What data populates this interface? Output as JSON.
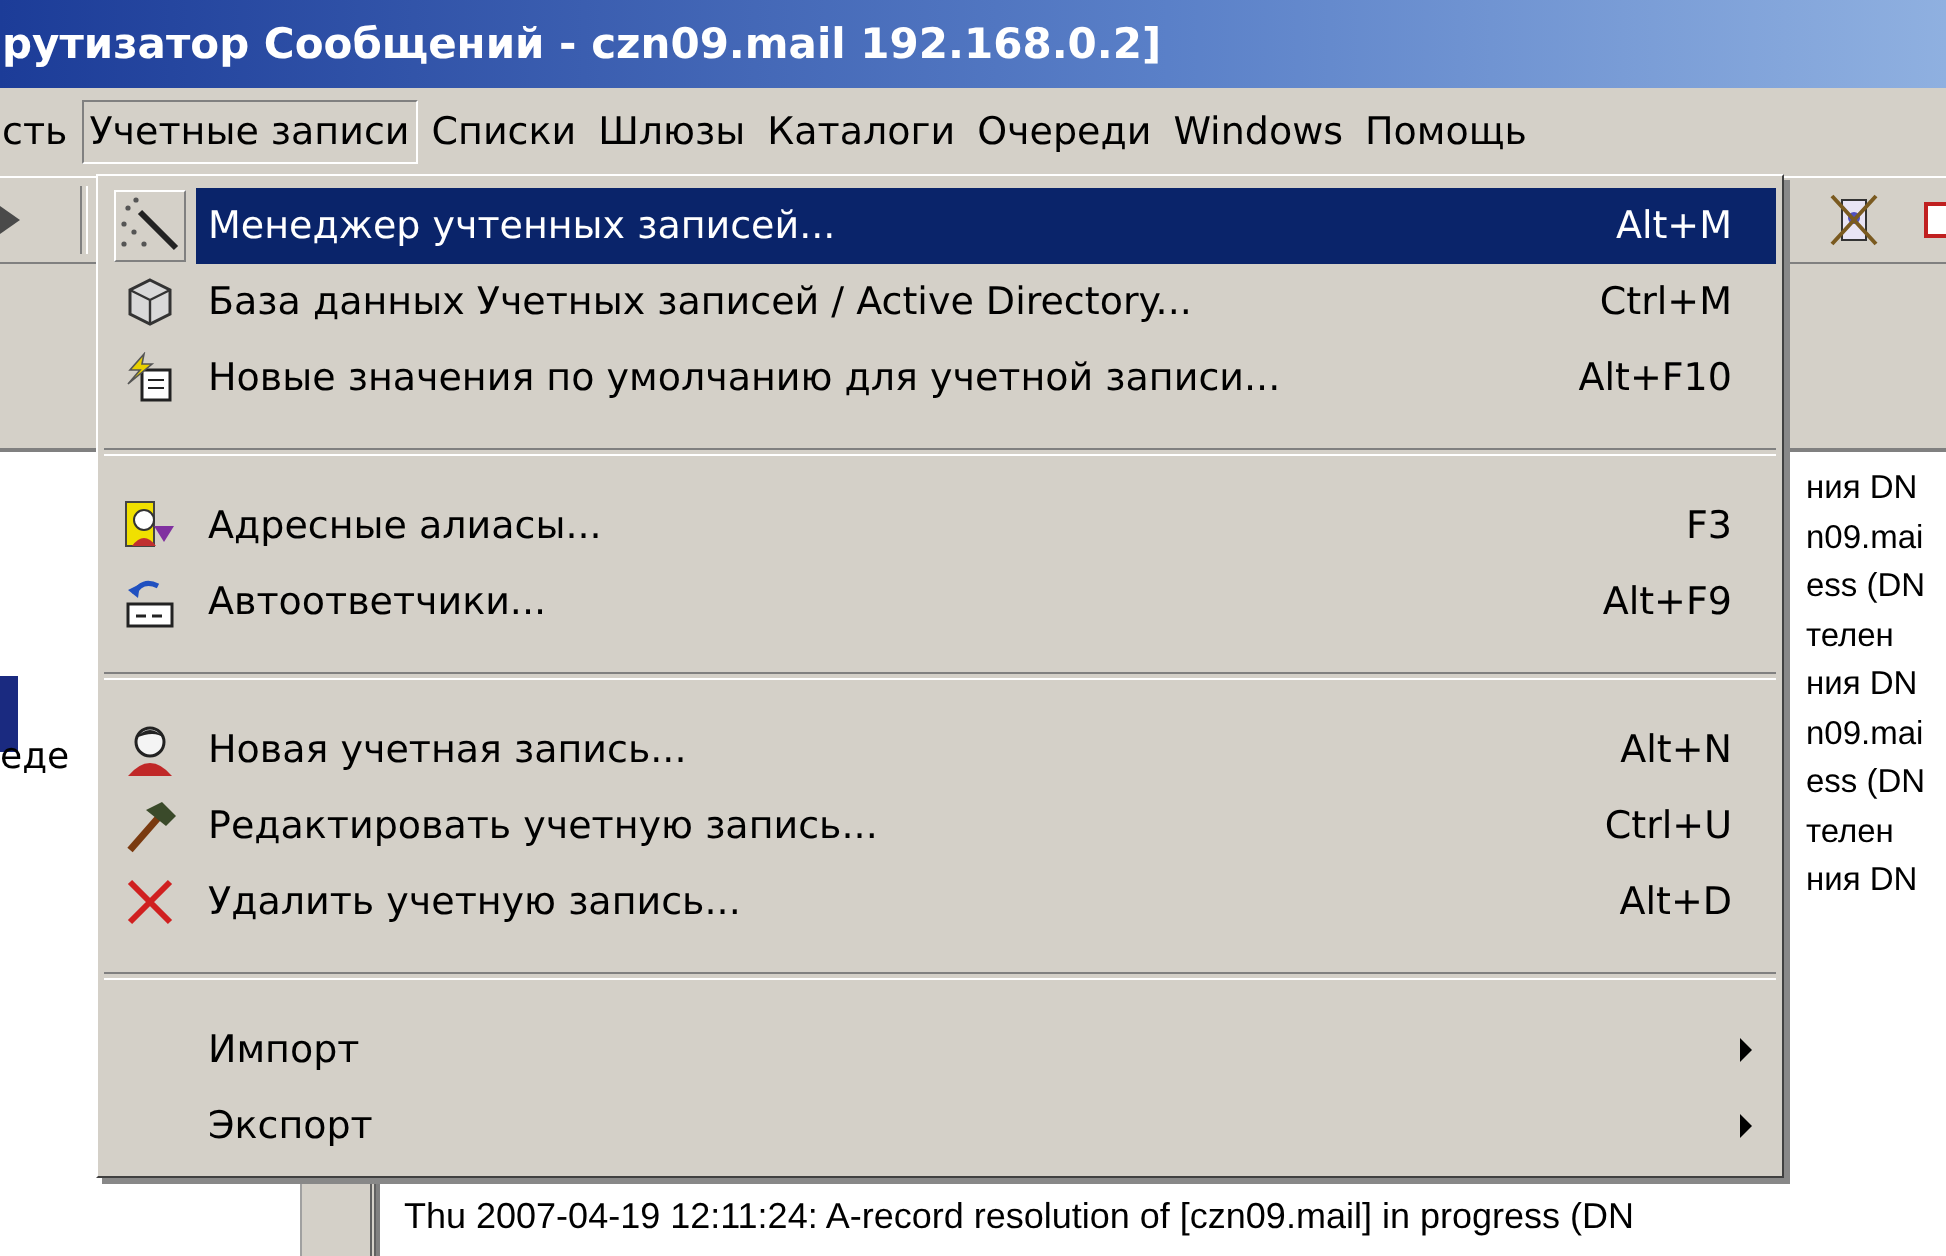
{
  "window": {
    "title": "рутизатор Сообщений  - czn09.mail 192.168.0.2]"
  },
  "menu_bar": [
    {
      "label": "сть",
      "selected": false
    },
    {
      "label": "Учетные записи",
      "selected": true
    },
    {
      "label": "Списки",
      "selected": false
    },
    {
      "label": "Шлюзы",
      "selected": false
    },
    {
      "label": "Каталоги",
      "selected": false
    },
    {
      "label": "Очереди",
      "selected": false
    },
    {
      "label": "Windows",
      "selected": false
    },
    {
      "label": "Помощь",
      "selected": false
    }
  ],
  "side_panel": {
    "text": "еде"
  },
  "log_fragments": [
    "ния DN",
    "n09.mai",
    "ess (DN",
    "телен",
    "ния DN",
    "n09.mai",
    "ess (DN",
    "телен",
    "ния DN"
  ],
  "log_lines": [
    "Thu 2007-04-19 12:11:24: A-record resolution of [czn09.mail] in progress (DN"
  ],
  "dropdown": {
    "items": [
      {
        "kind": "item",
        "label": "Менеджер учтенных записей...",
        "shortcut": "Alt+M",
        "selected": true
      },
      {
        "kind": "item",
        "label": "База данных Учетных записей / Active Directory...",
        "shortcut": "Ctrl+M",
        "selected": false
      },
      {
        "kind": "item",
        "label": "Новые значения по умолчанию для учетной записи...",
        "shortcut": "Alt+F10",
        "selected": false
      },
      {
        "kind": "separator"
      },
      {
        "kind": "item",
        "label": "Адресные алиасы...",
        "shortcut": "F3",
        "selected": false
      },
      {
        "kind": "item",
        "label": "Автоответчики...",
        "shortcut": "Alt+F9",
        "selected": false
      },
      {
        "kind": "separator"
      },
      {
        "kind": "item",
        "label": "Новая учетная запись...",
        "shortcut": "Alt+N",
        "selected": false
      },
      {
        "kind": "item",
        "label": "Редактировать учетную запись...",
        "shortcut": "Ctrl+U",
        "selected": false
      },
      {
        "kind": "item",
        "label": "Удалить учетную запись...",
        "shortcut": "Alt+D",
        "selected": false
      },
      {
        "kind": "separator"
      },
      {
        "kind": "submenu",
        "label": "Импорт",
        "selected": false
      },
      {
        "kind": "submenu",
        "label": "Экспорт",
        "selected": false
      }
    ]
  }
}
